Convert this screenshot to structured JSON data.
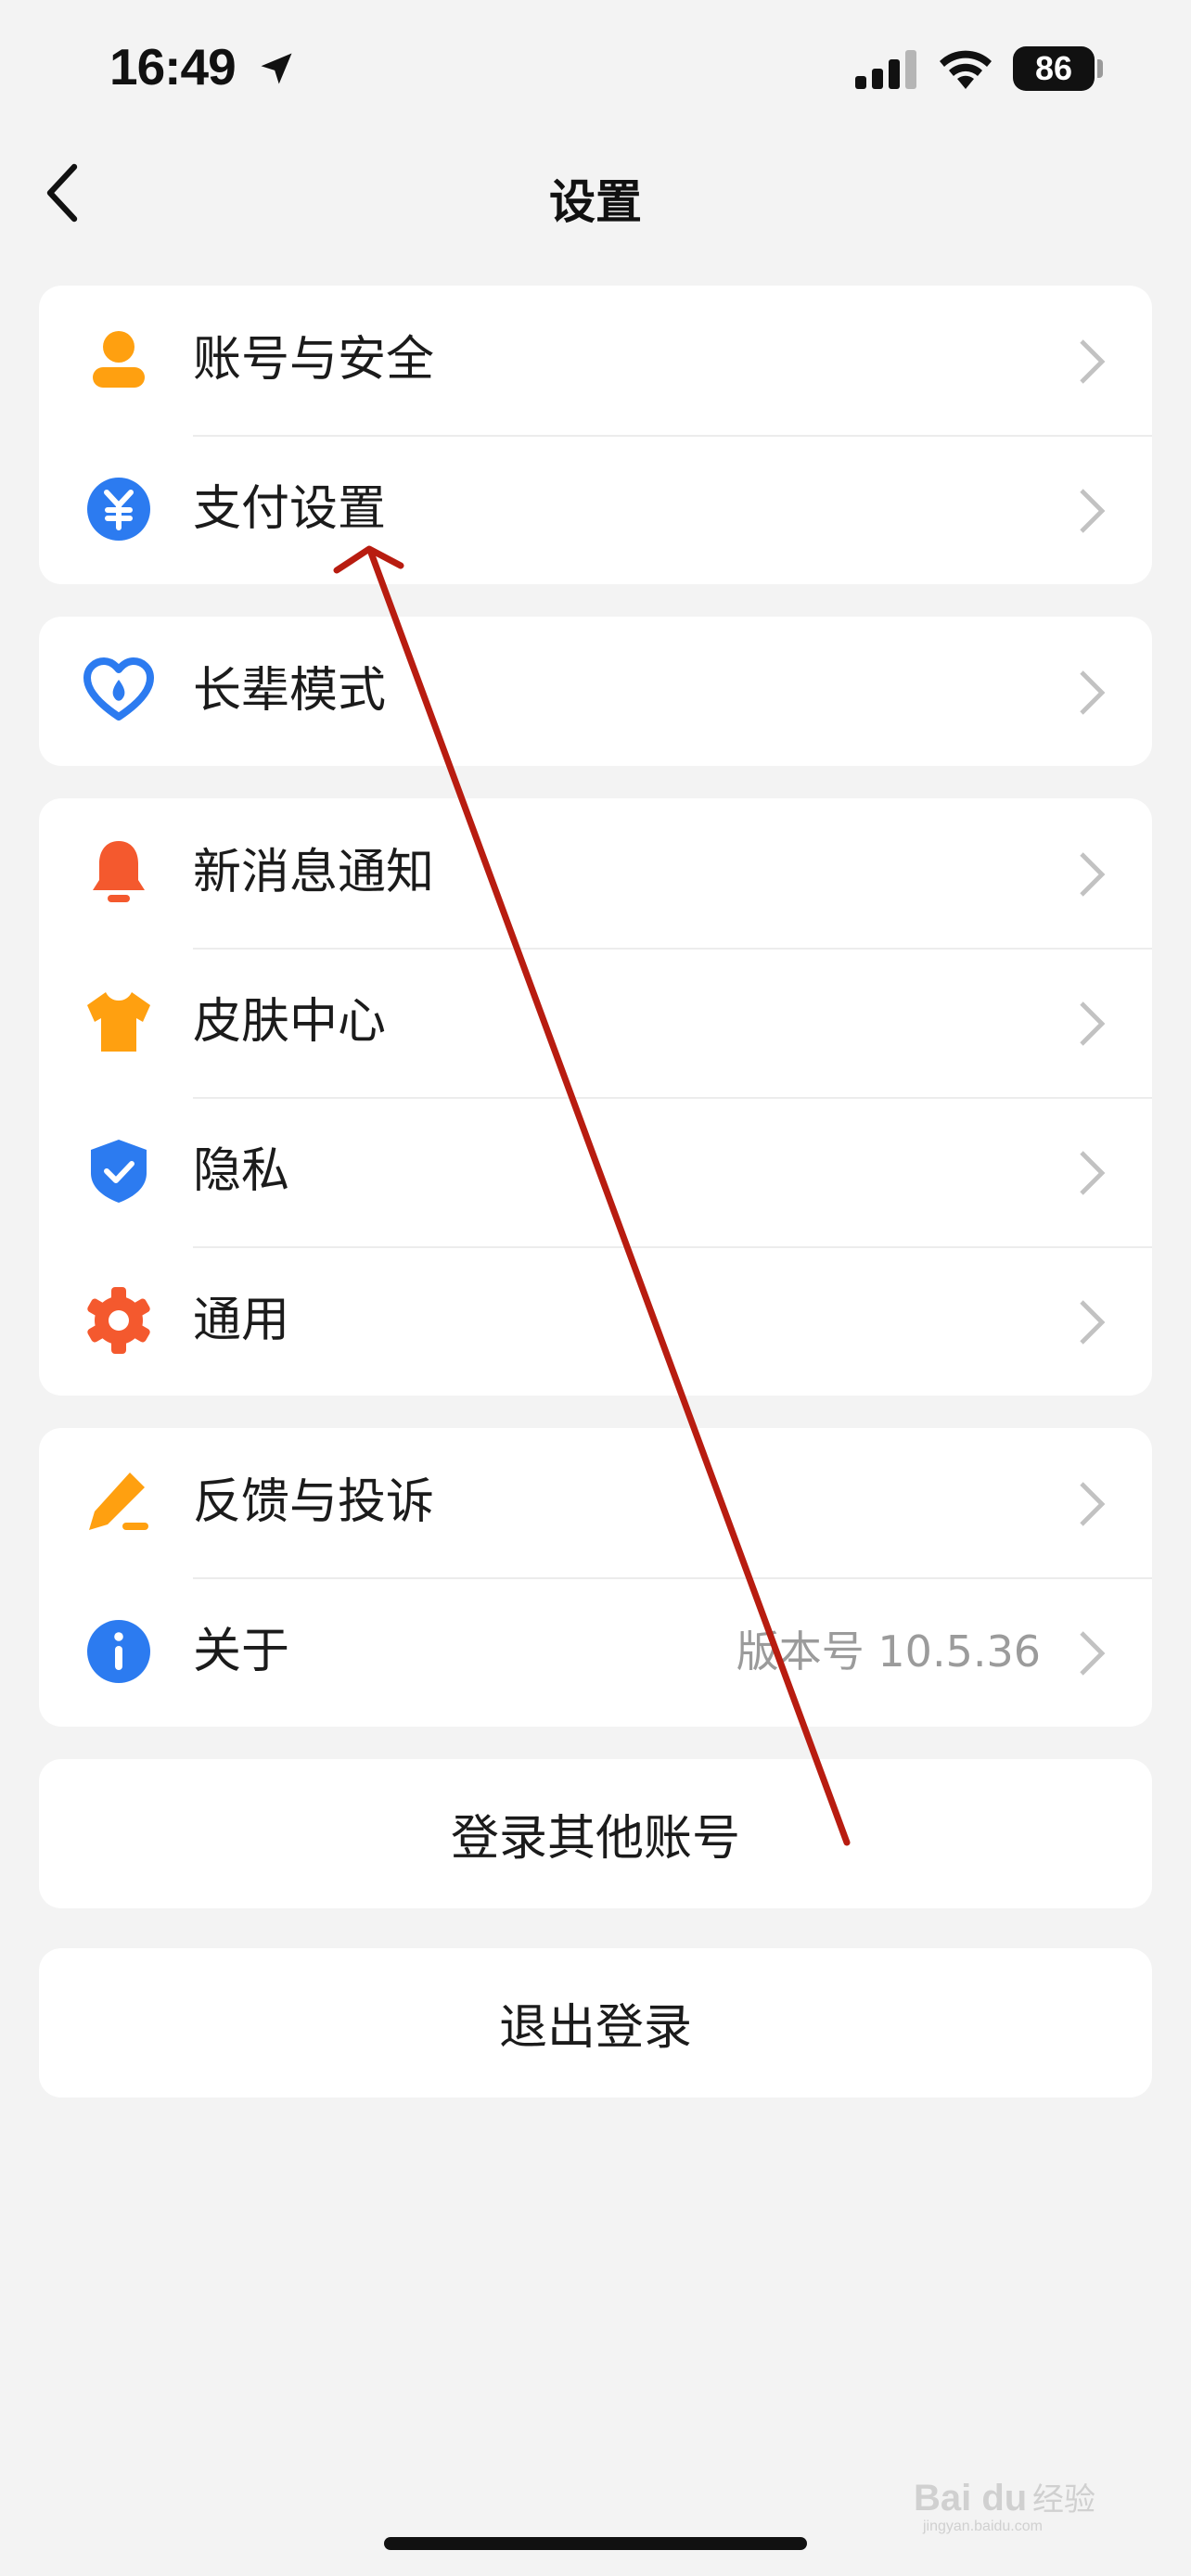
{
  "status_bar": {
    "time": "16:49",
    "battery": "86",
    "icons": [
      "location-arrow-icon",
      "cellular-signal-icon",
      "wifi-icon",
      "battery-icon"
    ]
  },
  "nav": {
    "title": "设置",
    "back_icon": "chevron-left-icon"
  },
  "groups": [
    {
      "items": [
        {
          "label": "账号与安全",
          "icon": "user-icon",
          "color": "#FFA010"
        },
        {
          "label": "支付设置",
          "icon": "yuan-icon",
          "color": "#2C7BF0"
        }
      ]
    },
    {
      "items": [
        {
          "label": "长辈模式",
          "icon": "heart-icon",
          "color": "#2C7BF0"
        }
      ]
    },
    {
      "items": [
        {
          "label": "新消息通知",
          "icon": "bell-icon",
          "color": "#F4592E"
        },
        {
          "label": "皮肤中心",
          "icon": "tshirt-icon",
          "color": "#FFA010"
        },
        {
          "label": "隐私",
          "icon": "shield-check-icon",
          "color": "#2C7BF0"
        },
        {
          "label": "通用",
          "icon": "gear-icon",
          "color": "#F4592E"
        }
      ]
    },
    {
      "items": [
        {
          "label": "反馈与投诉",
          "icon": "pencil-icon",
          "color": "#FFA010"
        },
        {
          "label": "关于",
          "icon": "info-icon",
          "color": "#2C7BF0",
          "value": "版本号 10.5.36"
        }
      ]
    }
  ],
  "actions": {
    "switch_account": "登录其他账号",
    "logout": "退出登录"
  },
  "annotation": {
    "arrow_color": "#B81C10"
  },
  "watermark": {
    "text": "Bai du 经验",
    "sub": "jingyan.baidu.com"
  }
}
